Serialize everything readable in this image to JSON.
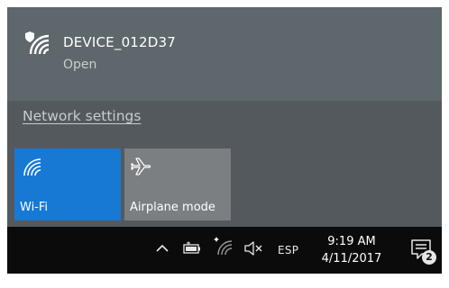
{
  "network": {
    "ssid": "DEVICE_012D37",
    "status": "Open",
    "icon": "wifi-secure-icon"
  },
  "settings_link": "Network settings",
  "quick_actions": [
    {
      "label": "Wi-Fi",
      "icon": "wifi-icon",
      "state": "on",
      "color": "#1779d4"
    },
    {
      "label": "Airplane mode",
      "icon": "airplane-icon",
      "state": "off",
      "color": "#7b7f82"
    }
  ],
  "taskbar": {
    "language": "ESP",
    "time": "9:19 AM",
    "date": "4/11/2017",
    "notification_count": "2",
    "icons": [
      "chevron-up-icon",
      "battery-icon",
      "wifi-icon",
      "volume-muted-icon",
      "action-center-icon"
    ]
  },
  "colors": {
    "flyout_bg": "#54595d",
    "network_item_bg": "#5e676b",
    "taskbar_bg": "#0b0b0c",
    "accent": "#1779d4"
  }
}
